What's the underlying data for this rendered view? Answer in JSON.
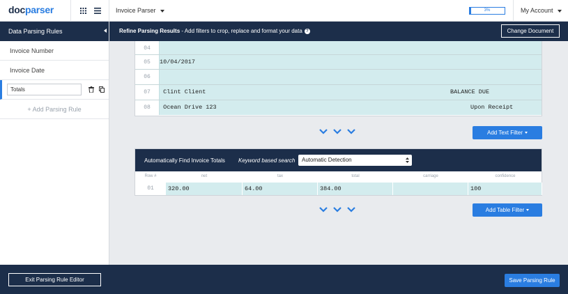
{
  "topbar": {
    "logo_main": "doc",
    "logo_accent": "parser",
    "parser_name": "Invoice Parser",
    "usage_label": "3%",
    "usage_fraction": 0.03,
    "account_label": "My Account"
  },
  "sidebar": {
    "header": "Data Parsing Rules",
    "rules": [
      {
        "label": "Invoice Number"
      },
      {
        "label": "Invoice Date"
      }
    ],
    "active_rule_value": "Totals",
    "add_rule_label": "+ Add Parsing Rule",
    "exit_label": "Exit Parsing Rule Editor"
  },
  "main": {
    "header_bold": "Refine Parsing Results",
    "header_rest": " - Add filters to crop, replace and format your data",
    "change_document_label": "Change Document",
    "preview_lines": [
      {
        "num": "04",
        "left": "",
        "right": ""
      },
      {
        "num": "05",
        "left": "10/04/2017",
        "right": ""
      },
      {
        "num": "06",
        "left": "",
        "right": ""
      },
      {
        "num": "07",
        "left": " Clint Client",
        "right": "BALANCE DUE"
      },
      {
        "num": "08",
        "left": " Ocean Drive 123",
        "right": "Upon Receipt"
      }
    ],
    "add_text_filter_label": "Add Text Filter",
    "add_table_filter_label": "Add Table Filter",
    "save_label": "Save Parsing Rule"
  },
  "totals": {
    "label": "Automatically Find Invoice Totals",
    "keyword_label": "Keyword based search",
    "select_value": "Automatic Detection",
    "columns": [
      "Row #",
      "net",
      "tax",
      "total",
      "carriage",
      "confidence"
    ],
    "row": {
      "num": "01",
      "net": "320.00",
      "tax": "64.00",
      "total": "384.00",
      "carriage": "",
      "confidence": "100"
    }
  },
  "colors": {
    "navy": "#1c2e4a",
    "accent": "#2a7de1",
    "highlight": "#d3ecee"
  }
}
